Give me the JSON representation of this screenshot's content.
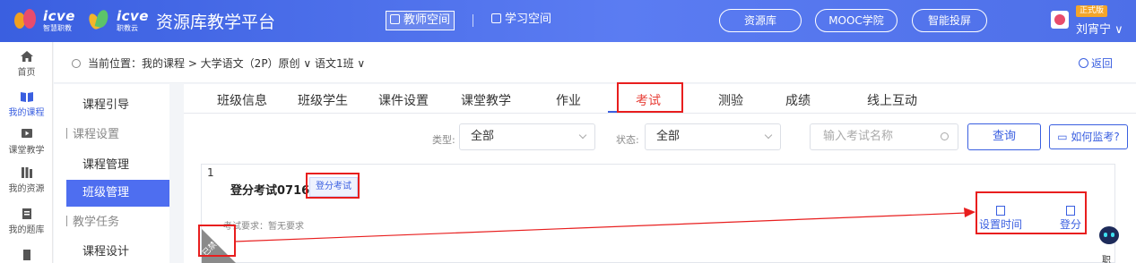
{
  "header": {
    "logo_primary_text": "icve",
    "logo_primary_sub": "智慧职教",
    "logo_secondary_text": "icve",
    "logo_secondary_sub": "职教云",
    "platform_title": "资源库教学平台",
    "space_tabs": [
      {
        "label": "教师空间",
        "active": true
      },
      {
        "label": "学习空间",
        "active": false
      }
    ],
    "pills": [
      "资源库",
      "MOOC学院",
      "智能投屏"
    ],
    "badge": "正式版",
    "user_name": "刘宵宁 ∨"
  },
  "left_nav": [
    {
      "label": "首页",
      "icon": "home-icon",
      "active": false
    },
    {
      "label": "我的课程",
      "icon": "book-icon",
      "active": true
    },
    {
      "label": "课堂教学",
      "icon": "play-icon",
      "active": false
    },
    {
      "label": "我的资源",
      "icon": "folder-icon",
      "active": false
    },
    {
      "label": "我的题库",
      "icon": "question-bank-icon",
      "active": false
    },
    {
      "label": "",
      "icon": "doc-icon",
      "active": false
    }
  ],
  "breadcrumb": {
    "text": "当前位置：我的课程 > 大学语文（2P）原创 ∨ 语文1班 ∨",
    "back_label": "返回"
  },
  "course_menu": [
    {
      "label": "课程引导",
      "type": "item",
      "active": false
    },
    {
      "label": "课程设置",
      "type": "group",
      "active": false
    },
    {
      "label": "课程管理",
      "type": "item",
      "active": false
    },
    {
      "label": "班级管理",
      "type": "item",
      "active": true
    },
    {
      "label": "教学任务",
      "type": "group",
      "active": false
    },
    {
      "label": "课程设计",
      "type": "item",
      "active": false
    }
  ],
  "tabs": [
    {
      "label": "班级信息"
    },
    {
      "label": "班级学生"
    },
    {
      "label": "课件设置"
    },
    {
      "label": "课堂教学"
    },
    {
      "label": "作业"
    },
    {
      "label": "考试",
      "active": true
    },
    {
      "label": "测验"
    },
    {
      "label": "成绩"
    },
    {
      "label": "线上互动"
    }
  ],
  "filters": {
    "type_label": "类型:",
    "type_value": "全部",
    "status_label": "状态:",
    "status_value": "全部",
    "search_placeholder": "输入考试名称",
    "query_button": "查询",
    "monitor_button": "如何监考?"
  },
  "exam": {
    "index": "1",
    "title": "登分考试0716",
    "tag": "登分考试",
    "requirement": "考试要求：暂无要求",
    "ribbon": "已禁用",
    "actions": [
      {
        "label": "设置时间",
        "icon": "upload-icon"
      },
      {
        "label": "登分",
        "icon": "grade-icon"
      }
    ]
  },
  "assistant_caption": "职",
  "colors": {
    "header_blue": "#3a5fe0",
    "accent_blue": "#3a5fe0",
    "highlight_red": "#e81e1e",
    "active_menu": "#4e6ef0"
  }
}
